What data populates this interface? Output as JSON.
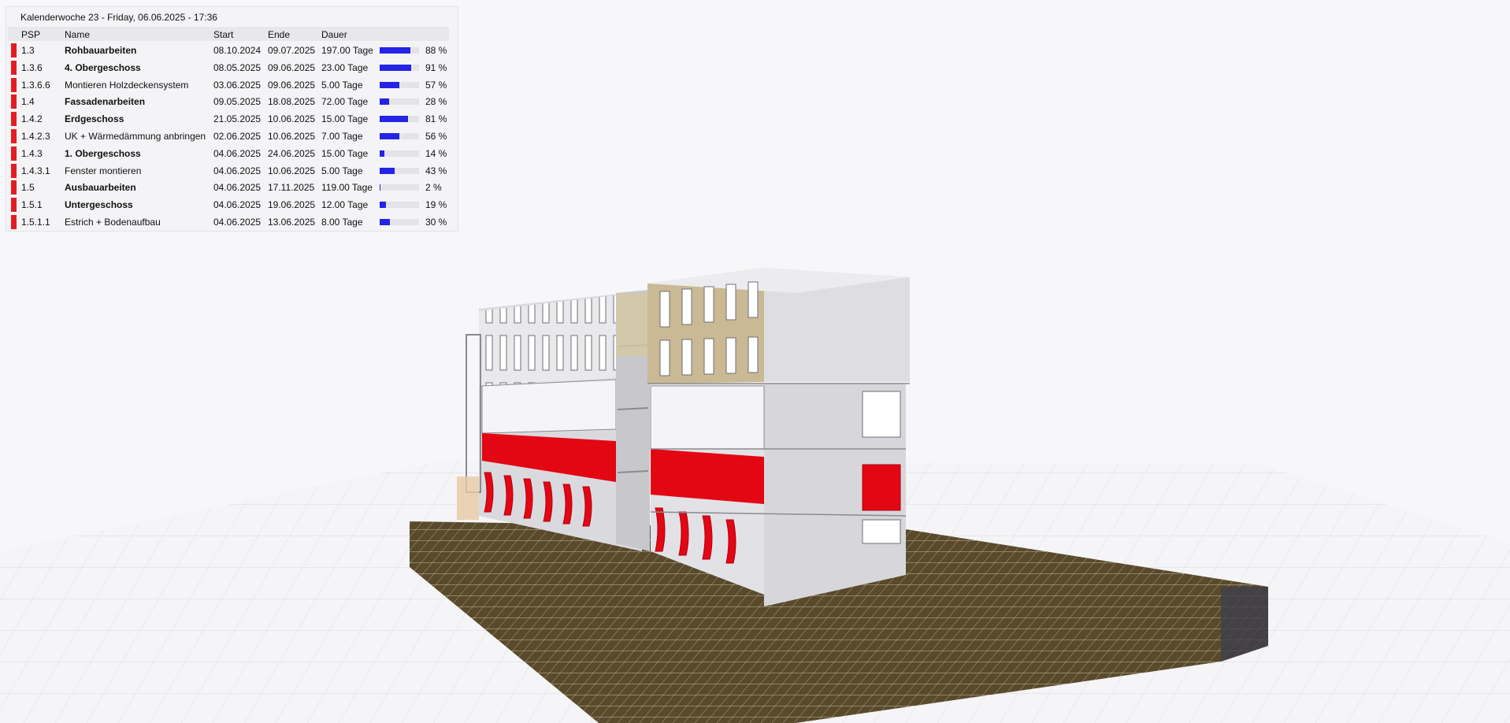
{
  "panel": {
    "title": "Kalenderwoche 23 - Friday, 06.06.2025 - 17:36",
    "headers": {
      "psp": "PSP",
      "name": "Name",
      "start": "Start",
      "ende": "Ende",
      "dauer": "Dauer"
    },
    "rows": [
      {
        "psp": "1.3",
        "name": "Rohbauarbeiten",
        "bold": true,
        "start": "08.10.2024",
        "ende": "09.07.2025",
        "dauer": "197.00 Tage",
        "progress": 0.88,
        "percent": "88 %"
      },
      {
        "psp": "1.3.6",
        "name": "4. Obergeschoss",
        "bold": true,
        "start": "08.05.2025",
        "ende": "09.06.2025",
        "dauer": "23.00 Tage",
        "progress": 0.91,
        "percent": "91 %"
      },
      {
        "psp": "1.3.6.6",
        "name": "Montieren Holzdeckensystem",
        "bold": false,
        "start": "03.06.2025",
        "ende": "09.06.2025",
        "dauer": "5.00 Tage",
        "progress": 0.57,
        "percent": "57 %"
      },
      {
        "psp": "1.4",
        "name": "Fassadenarbeiten",
        "bold": true,
        "start": "09.05.2025",
        "ende": "18.08.2025",
        "dauer": "72.00 Tage",
        "progress": 0.28,
        "percent": "28 %"
      },
      {
        "psp": "1.4.2",
        "name": "Erdgeschoss",
        "bold": true,
        "start": "21.05.2025",
        "ende": "10.06.2025",
        "dauer": "15.00 Tage",
        "progress": 0.81,
        "percent": "81 %"
      },
      {
        "psp": "1.4.2.3",
        "name": "UK + Wärmedämmung anbringen",
        "bold": false,
        "start": "02.06.2025",
        "ende": "10.06.2025",
        "dauer": "7.00 Tage",
        "progress": 0.56,
        "percent": "56 %"
      },
      {
        "psp": "1.4.3",
        "name": "1. Obergeschoss",
        "bold": true,
        "start": "04.06.2025",
        "ende": "24.06.2025",
        "dauer": "15.00 Tage",
        "progress": 0.14,
        "percent": "14 %"
      },
      {
        "psp": "1.4.3.1",
        "name": "Fenster montieren",
        "bold": false,
        "start": "04.06.2025",
        "ende": "10.06.2025",
        "dauer": "5.00 Tage",
        "progress": 0.43,
        "percent": "43 %"
      },
      {
        "psp": "1.5",
        "name": "Ausbauarbeiten",
        "bold": true,
        "start": "04.06.2025",
        "ende": "17.11.2025",
        "dauer": "119.00 Tage",
        "progress": 0.02,
        "percent": "2 %"
      },
      {
        "psp": "1.5.1",
        "name": "Untergeschoss",
        "bold": true,
        "start": "04.06.2025",
        "ende": "19.06.2025",
        "dauer": "12.00 Tage",
        "progress": 0.19,
        "percent": "19 %"
      },
      {
        "psp": "1.5.1.1",
        "name": "Estrich + Bodenaufbau",
        "bold": false,
        "start": "04.06.2025",
        "ende": "13.06.2025",
        "dauer": "8.00 Tage",
        "progress": 0.3,
        "percent": "30 %"
      }
    ]
  },
  "colors": {
    "status_red": "#e41d24",
    "progress_blue": "#2424e6",
    "facade_red": "#e30613",
    "excavation_brown": "#5a4a2c",
    "wood_panel": "#c9b994"
  }
}
